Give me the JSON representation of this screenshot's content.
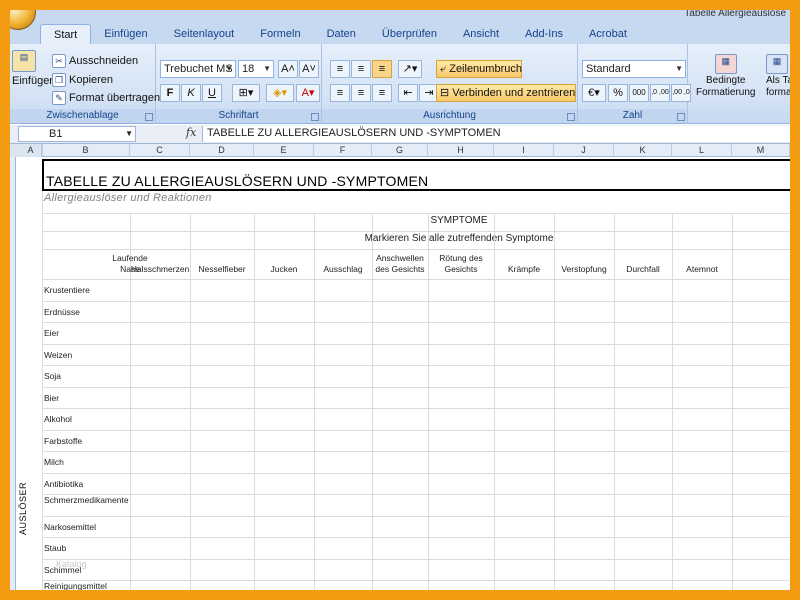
{
  "window": {
    "title": "Tabelle Allergieauslöse"
  },
  "tabs": [
    "Start",
    "Einfügen",
    "Seitenlayout",
    "Formeln",
    "Daten",
    "Überprüfen",
    "Ansicht",
    "Add-Ins",
    "Acrobat"
  ],
  "ribbon": {
    "clipboard": {
      "paste": "Einfügen",
      "cut": "Ausschneiden",
      "copy": "Kopieren",
      "format_painter": "Format übertragen",
      "label": "Zwischenablage"
    },
    "font": {
      "name": "Trebuchet MS",
      "size": "18",
      "bold": "F",
      "italic": "K",
      "underline": "U",
      "label": "Schriftart"
    },
    "alignment": {
      "wrap": "Zeilenumbruch",
      "merge": "Verbinden und zentrieren",
      "label": "Ausrichtung"
    },
    "number": {
      "format": "Standard",
      "percent": "%",
      "thousands": "000",
      "inc_decimal": ",0 ,00",
      "dec_decimal": ",00 ,0",
      "label": "Zahl"
    },
    "styles": {
      "conditional": "Bedingte",
      "conditional2": "Formatierung",
      "table": "Als Ta",
      "table2": "formati"
    }
  },
  "formula_bar": {
    "cell": "B1",
    "fx": "fx",
    "content": "TABELLE ZU ALLERGIEAUSLÖSERN UND -SYMPTOMEN"
  },
  "columns": [
    "A",
    "B",
    "C",
    "D",
    "E",
    "F",
    "G",
    "H",
    "I",
    "J",
    "K",
    "L",
    "M"
  ],
  "sheet": {
    "title": "TABELLE ZU ALLERGIEAUSLÖSERN UND -SYMPTOMEN",
    "subtitle": "Allergieauslöser und Reaktionen",
    "symptoms_header": "SYMPTOME",
    "instruction": "Markieren Sie alle zutreffenden Symptome",
    "symptoms": [
      "Laufende Nase",
      "Halsschmerzen",
      "Nesselfieber",
      "Jucken",
      "Ausschlag",
      "Anschwellen des Gesichts",
      "Rötung des Gesichts",
      "Krämpfe",
      "Verstopfung",
      "Durchfall",
      "Atemnot"
    ],
    "triggers_label": "AUSLÖSER",
    "triggers": [
      "Krustentiere",
      "Erdnüsse",
      "Eier",
      "Weizen",
      "Soja",
      "Bier",
      "Alkohol",
      "Farbstoffe",
      "Milch",
      "Antibiotika",
      "Schmerzmedikamente",
      "Narkosemittel",
      "Staub",
      "Schimmel",
      "Reinigungsmittel"
    ],
    "watermark": "Katalog"
  },
  "colors": {
    "frame": "#f39c12",
    "ribbon": "#d3e2f5",
    "accent": "#f8c96a"
  }
}
